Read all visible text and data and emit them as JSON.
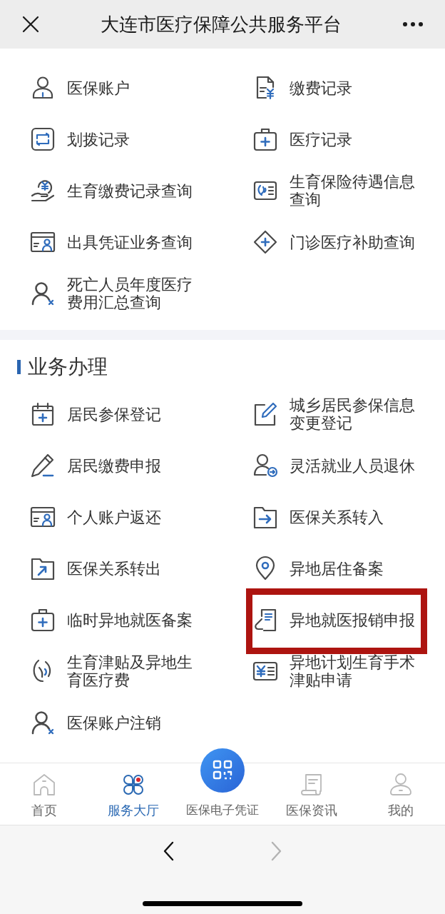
{
  "header": {
    "title": "大连市医疗保障公共服务平台"
  },
  "personal_services": {
    "items": [
      {
        "label": "医保账户"
      },
      {
        "label": "缴费记录"
      },
      {
        "label": "划拨记录"
      },
      {
        "label": "医疗记录"
      },
      {
        "label": "生育缴费记录查询"
      },
      {
        "label": "生育保险待遇信息查询"
      },
      {
        "label": "出具凭证业务查询"
      },
      {
        "label": "门诊医疗补助查询"
      },
      {
        "label": "死亡人员年度医疗费用汇总查询"
      }
    ]
  },
  "business_services": {
    "title": "业务办理",
    "items": [
      {
        "label": "居民参保登记",
        "highlighted": false
      },
      {
        "label": "城乡居民参保信息变更登记",
        "highlighted": false
      },
      {
        "label": "居民缴费申报",
        "highlighted": false
      },
      {
        "label": "灵活就业人员退休",
        "highlighted": false
      },
      {
        "label": "个人账户返还",
        "highlighted": false
      },
      {
        "label": "医保关系转入",
        "highlighted": false
      },
      {
        "label": "医保关系转出",
        "highlighted": false
      },
      {
        "label": "异地居住备案",
        "highlighted": false
      },
      {
        "label": "临时异地就医备案",
        "highlighted": false
      },
      {
        "label": "异地就医报销申报",
        "highlighted": true
      },
      {
        "label": "生育津贴及异地生育医疗费",
        "highlighted": false
      },
      {
        "label": "异地计划生育手术津贴申请",
        "highlighted": false
      },
      {
        "label": "医保账户注销",
        "highlighted": false
      }
    ]
  },
  "tab_bar": [
    {
      "label": "首页",
      "kind": "tab",
      "selected": false
    },
    {
      "label": "服务大厅",
      "kind": "tab",
      "selected": true
    },
    {
      "label": "医保电子凭证",
      "kind": "raised",
      "selected": false
    },
    {
      "label": "医保资讯",
      "kind": "tab",
      "selected": false
    },
    {
      "label": "我的",
      "kind": "tab",
      "selected": false
    }
  ],
  "browser_nav": {
    "back": {
      "disabled": false
    },
    "forward": {
      "disabled": true
    }
  }
}
